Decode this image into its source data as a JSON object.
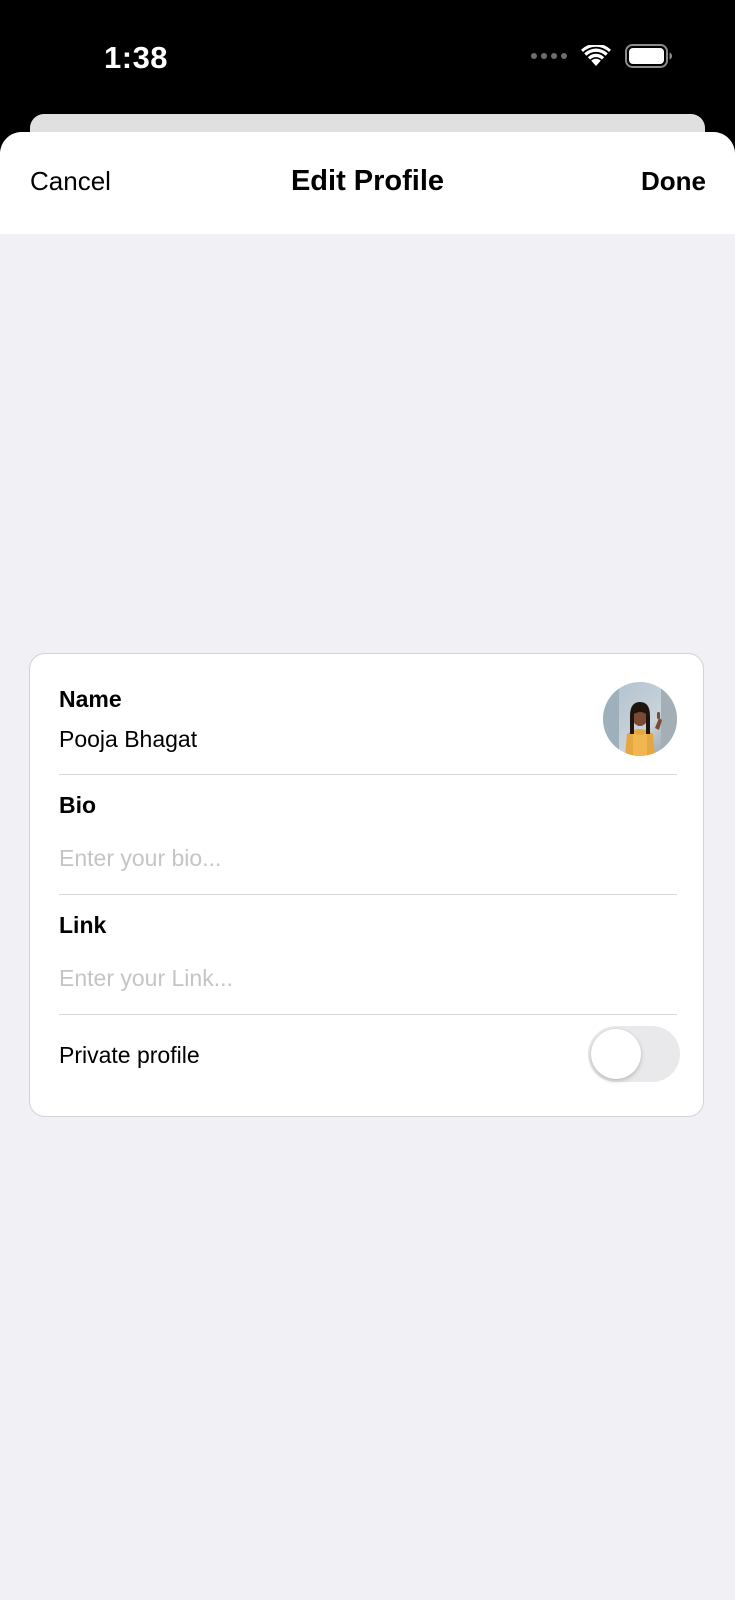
{
  "status_bar": {
    "time": "1:38",
    "wifi_icon": "wifi-icon",
    "battery_icon": "battery-icon",
    "signal_icon": "cellular-dots-icon"
  },
  "nav": {
    "cancel_label": "Cancel",
    "title": "Edit Profile",
    "done_label": "Done"
  },
  "form": {
    "name": {
      "label": "Name",
      "value": "Pooja Bhagat"
    },
    "bio": {
      "label": "Bio",
      "placeholder": "Enter your bio...",
      "value": ""
    },
    "link": {
      "label": "Link",
      "placeholder": "Enter your Link...",
      "value": ""
    },
    "private_profile": {
      "label": "Private profile",
      "enabled": false
    }
  },
  "colors": {
    "background": "#f1f0f5",
    "card": "#ffffff",
    "placeholder": "#c5c5c7",
    "toggle_off": "#e9e9eb",
    "divider": "#d6d6d8"
  }
}
